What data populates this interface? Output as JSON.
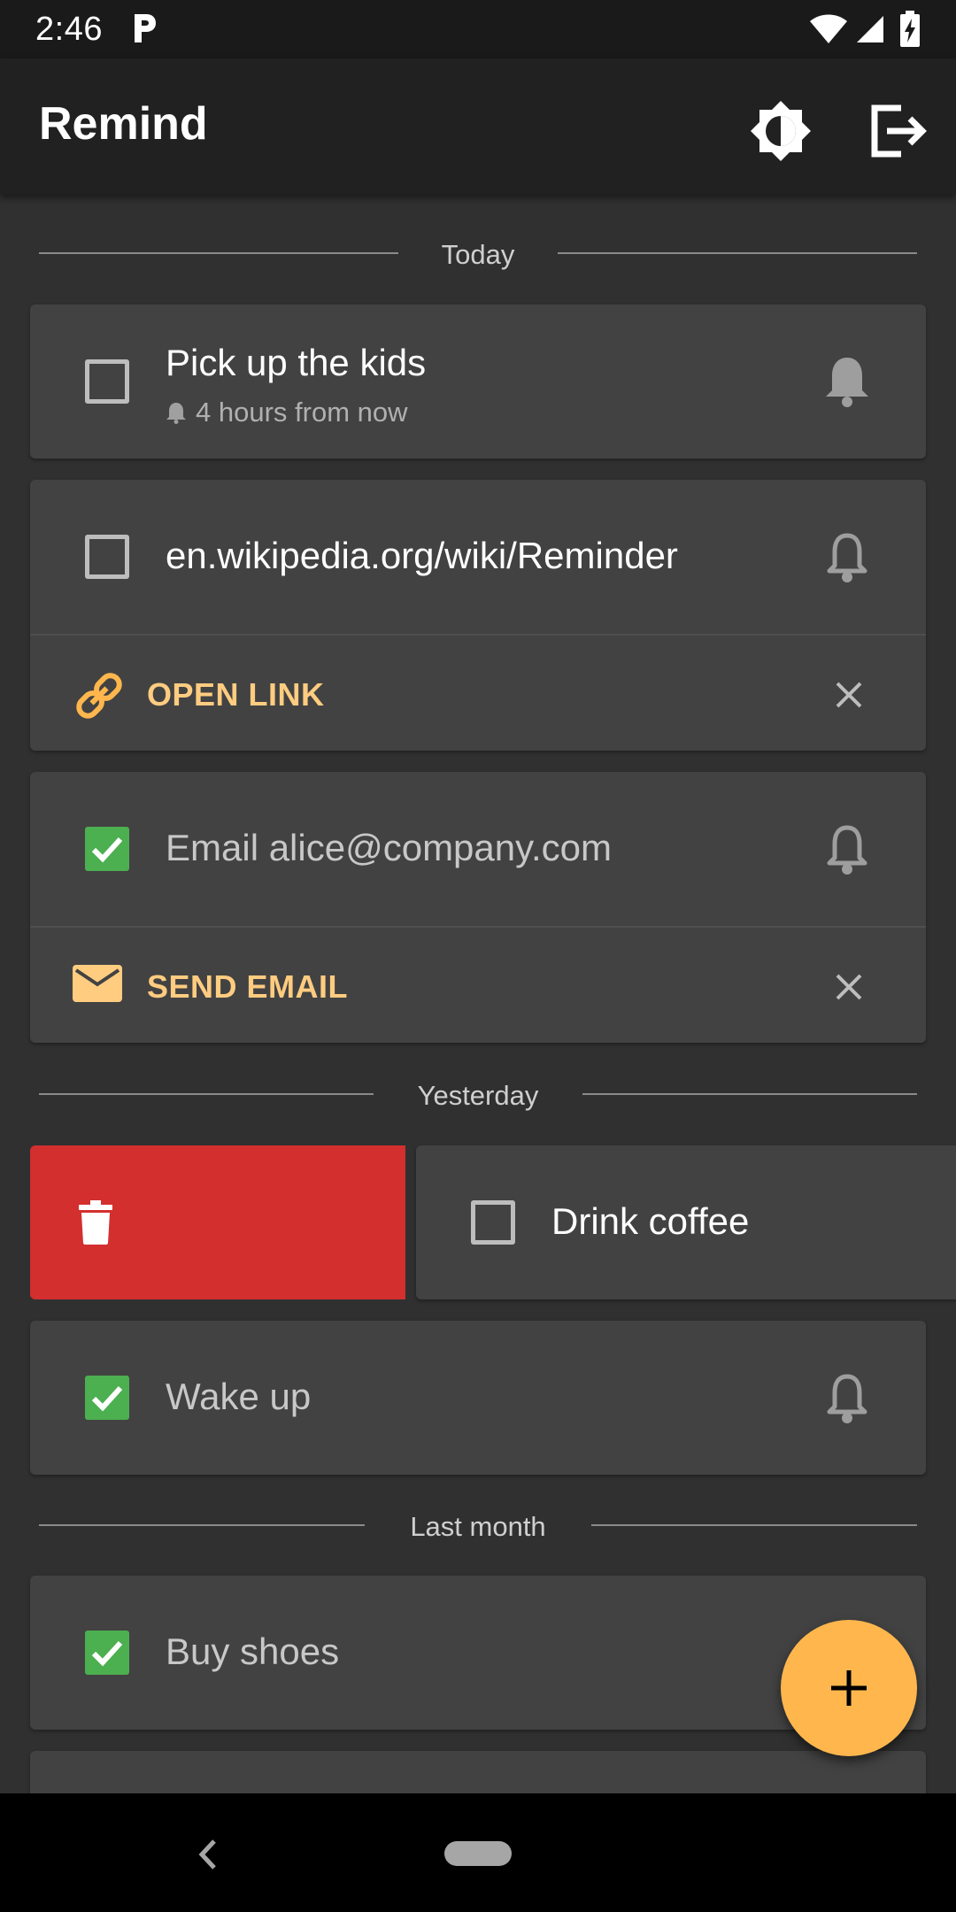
{
  "status_bar": {
    "time": "2:46"
  },
  "app_bar": {
    "title": "Remind"
  },
  "sections": {
    "today": "Today",
    "yesterday": "Yesterday",
    "last_month": "Last month"
  },
  "reminders": {
    "pick_up_kids": {
      "text": "Pick up the kids",
      "subtext": "4 hours from now",
      "checked": false
    },
    "wikipedia": {
      "text": "en.wikipedia.org/wiki/Reminder",
      "checked": false,
      "action": "OPEN LINK"
    },
    "email_alice": {
      "text": "Email alice@company.com",
      "checked": true,
      "action": "SEND EMAIL"
    },
    "drink_coffee": {
      "text": "Drink coffee",
      "checked": false
    },
    "wake_up": {
      "text": "Wake up",
      "checked": true
    },
    "buy_shoes": {
      "text": "Buy shoes",
      "checked": true
    }
  },
  "colors": {
    "background": "#303030",
    "card": "#424242",
    "accent": "#ffb74d",
    "action_text": "#ffcc80",
    "check_green": "#4caf50",
    "delete_red": "#d32f2f"
  }
}
